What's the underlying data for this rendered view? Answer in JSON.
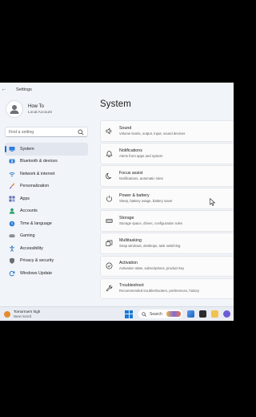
{
  "window": {
    "title": "Settings"
  },
  "profile": {
    "name": "How To",
    "account": "Local Account"
  },
  "search": {
    "placeholder": "Find a setting"
  },
  "nav": [
    {
      "label": "System",
      "icon": "monitor-icon",
      "active": true
    },
    {
      "label": "Bluetooth & devices",
      "icon": "bluetooth-icon"
    },
    {
      "label": "Network & internet",
      "icon": "wifi-icon"
    },
    {
      "label": "Personalization",
      "icon": "brush-icon"
    },
    {
      "label": "Apps",
      "icon": "apps-icon"
    },
    {
      "label": "Accounts",
      "icon": "person-icon"
    },
    {
      "label": "Time & language",
      "icon": "globe-clock-icon"
    },
    {
      "label": "Gaming",
      "icon": "gamepad-icon"
    },
    {
      "label": "Accessibility",
      "icon": "accessibility-icon"
    },
    {
      "label": "Privacy & security",
      "icon": "shield-icon"
    },
    {
      "label": "Windows Update",
      "icon": "update-icon"
    }
  ],
  "main": {
    "title": "System",
    "cards": [
      {
        "title": "Sound",
        "subtitle": "Volume levels, output, input, sound devices",
        "icon": "speaker-icon"
      },
      {
        "title": "Notifications",
        "subtitle": "Alerts from apps and system",
        "icon": "bell-icon"
      },
      {
        "title": "Focus assist",
        "subtitle": "Notifications, automatic rules",
        "icon": "moon-icon"
      },
      {
        "title": "Power & battery",
        "subtitle": "Sleep, battery usage, battery saver",
        "icon": "power-icon"
      },
      {
        "title": "Storage",
        "subtitle": "Storage space, drives, configuration rules",
        "icon": "storage-icon"
      },
      {
        "title": "Multitasking",
        "subtitle": "Snap windows, desktops, task switching",
        "icon": "multitask-icon"
      },
      {
        "title": "Activation",
        "subtitle": "Activation state, subscriptions, product key",
        "icon": "check-circle-icon"
      },
      {
        "title": "Troubleshoot",
        "subtitle": "Recommended troubleshooters, preferences, history",
        "icon": "wrench-icon"
      }
    ]
  },
  "taskbar": {
    "weather_title": "Tomorrow's high",
    "weather_sub": "Near record",
    "search_label": "Search"
  },
  "colors": {
    "accent": "#1a6fd0",
    "background": "#f1f4f9"
  }
}
